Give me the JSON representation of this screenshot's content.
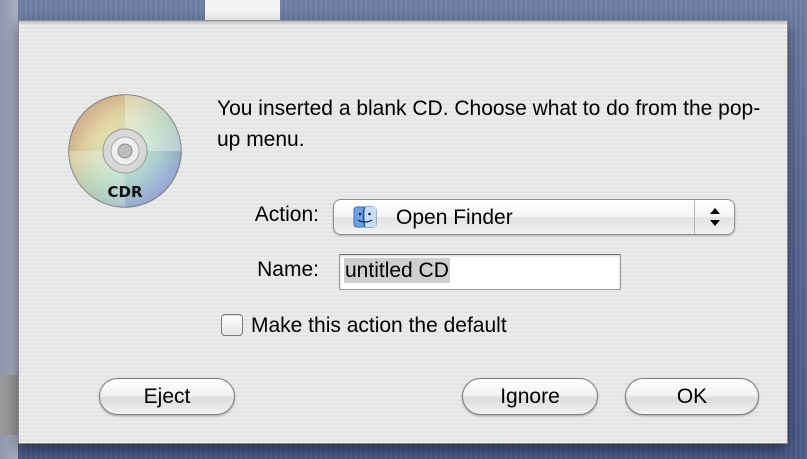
{
  "dialog": {
    "icon": "cd-r-disc-icon",
    "icon_label": "CDR",
    "message": "You inserted a blank CD. Choose what to do from the pop-up menu.",
    "action_label": "Action:",
    "action_value": "Open Finder",
    "action_icon": "finder-icon",
    "name_label": "Name:",
    "name_value": "untitled CD",
    "checkbox_label": "Make this action the default",
    "checkbox_checked": false,
    "buttons": {
      "eject": "Eject",
      "ignore": "Ignore",
      "ok": "OK"
    }
  },
  "colors": {
    "dialog_bg": "#ececec",
    "desktop_bg": "#5c6d98",
    "selection": "#cfcfcf"
  }
}
